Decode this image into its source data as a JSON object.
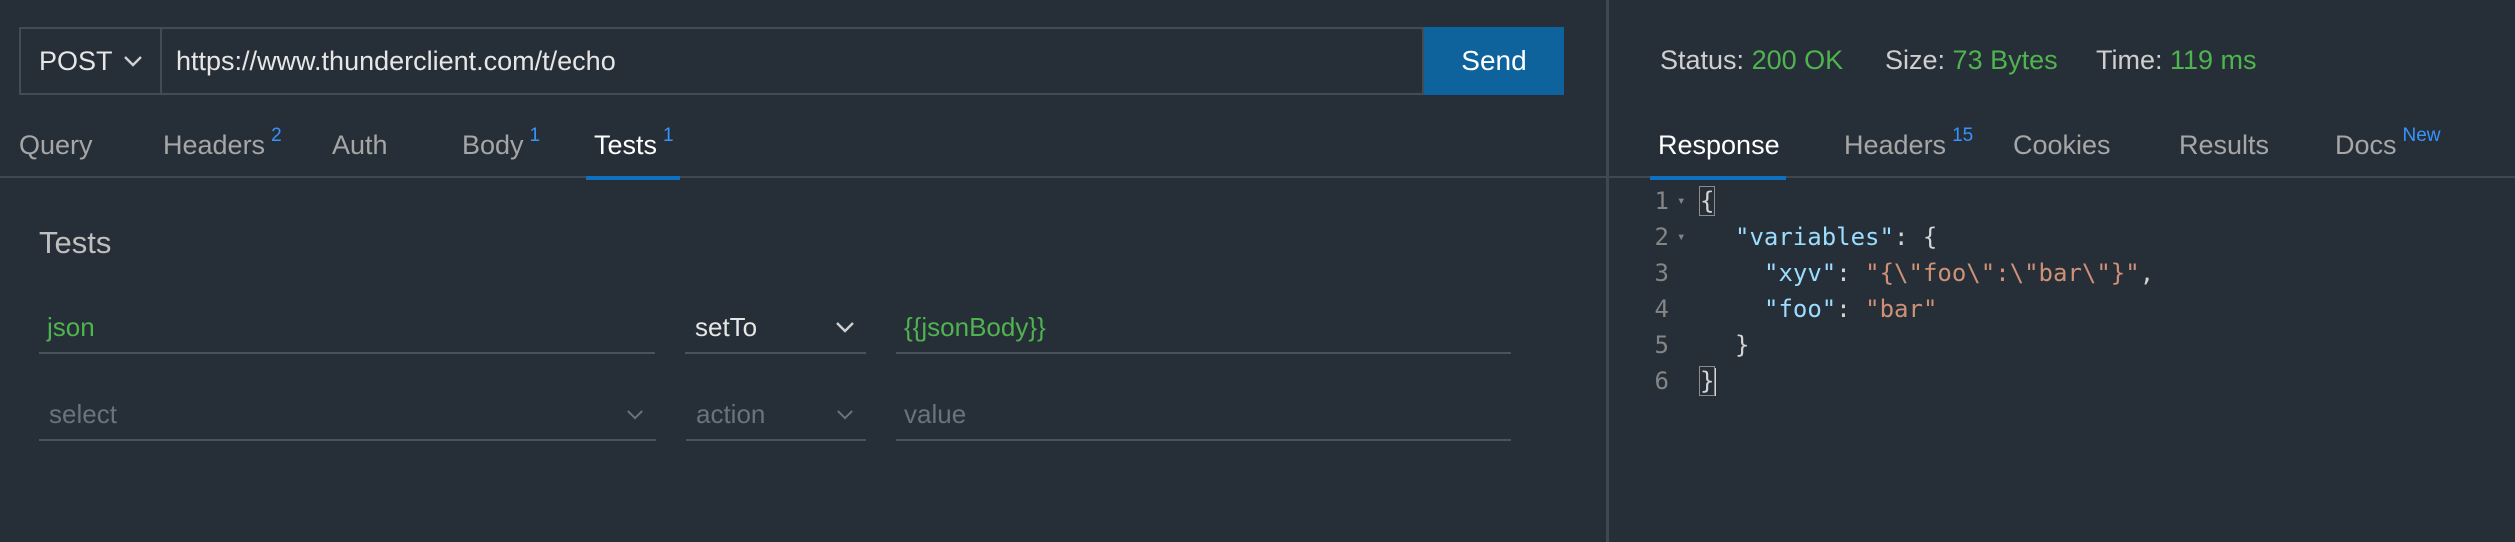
{
  "request": {
    "method": "POST",
    "url": "https://www.thunderclient.com/t/echo",
    "send_label": "Send"
  },
  "request_tabs": [
    {
      "label": "Query",
      "count": ""
    },
    {
      "label": "Headers",
      "count": "2"
    },
    {
      "label": "Auth",
      "count": ""
    },
    {
      "label": "Body",
      "count": "1"
    },
    {
      "label": "Tests",
      "count": "1",
      "active": true
    }
  ],
  "tests": {
    "title": "Tests",
    "rows": [
      {
        "type": "json",
        "type_placeholder": "select",
        "action": "setTo",
        "action_placeholder": "action",
        "value": "{{jsonBody}}",
        "value_placeholder": "value"
      },
      {
        "type": "",
        "type_placeholder": "select",
        "action": "",
        "action_placeholder": "action",
        "value": "",
        "value_placeholder": "value"
      }
    ]
  },
  "response_status": {
    "status_label": "Status:",
    "status_value": "200 OK",
    "size_label": "Size:",
    "size_value": "73 Bytes",
    "time_label": "Time:",
    "time_value": "119 ms"
  },
  "response_tabs": [
    {
      "label": "Response",
      "badge": "",
      "active": true
    },
    {
      "label": "Headers",
      "badge": "15"
    },
    {
      "label": "Cookies",
      "badge": ""
    },
    {
      "label": "Results",
      "badge": ""
    },
    {
      "label": "Docs",
      "badge": "New"
    }
  ],
  "response_body": {
    "line_numbers": [
      "1",
      "2",
      "3",
      "4",
      "5",
      "6"
    ],
    "l1": "{",
    "l2_key": "\"variables\"",
    "l2_rest": ": {",
    "l3_key": "\"xyv\"",
    "l3_colon": ": ",
    "l3_value": "\"{\\\"foo\\\":\\\"bar\\\"}\"",
    "l3_comma": ",",
    "l4_key": "\"foo\"",
    "l4_colon": ": ",
    "l4_value": "\"bar\"",
    "l5": "}",
    "l6": "}"
  },
  "colors": {
    "background": "#262f37",
    "accent": "#0e639c",
    "success": "#4fb34f",
    "badge": "#3794ff"
  }
}
